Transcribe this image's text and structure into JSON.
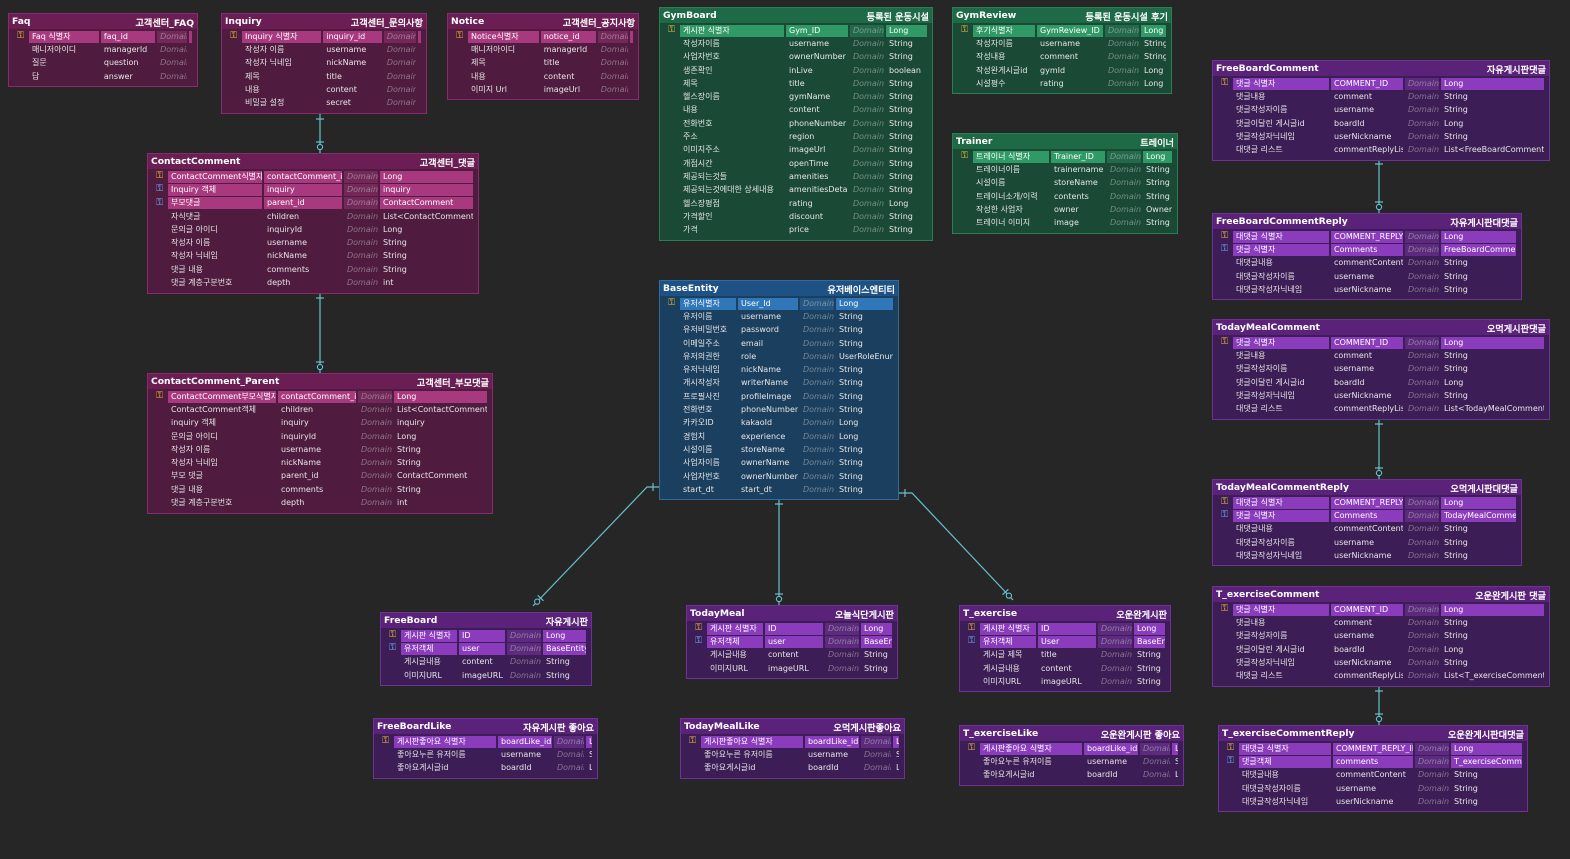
{
  "colors": {
    "background": "#262626",
    "pink": "#6a1e53",
    "green": "#1e6a46",
    "blue": "#1e5285",
    "purple": "#5a2379",
    "connector": "#66c2cc",
    "pk_key": "#f1c232",
    "fk_key": "#6fb4ff"
  },
  "entities": [
    {
      "id": "faq",
      "theme": "pink",
      "name": "Faq",
      "label": "고객센터_FAQ",
      "cols": [
        80,
        62,
        34
      ],
      "rows": [
        [
          "pk",
          "Faq 식별자",
          "faq_id",
          "Domain",
          "Long"
        ],
        [
          "",
          "매니저아이디",
          "managerId",
          "Domain",
          "Long"
        ],
        [
          "",
          "질문",
          "question",
          "Domain",
          "String"
        ],
        [
          "",
          "답",
          "answer",
          "Domain",
          "String"
        ]
      ]
    },
    {
      "id": "inquiry",
      "theme": "pink",
      "name": "Inquiry",
      "label": "고객센터_문의사항",
      "cols": [
        84,
        62,
        34
      ],
      "rows": [
        [
          "pk",
          "Inquiry 식별자",
          "inquiry_id",
          "Domain",
          "Long"
        ],
        [
          "",
          "작성자 이름",
          "username",
          "Domain",
          "String"
        ],
        [
          "",
          "작성자 닉네임",
          "nickName",
          "Domain",
          "String"
        ],
        [
          "",
          "제목",
          "title",
          "Domain",
          "String"
        ],
        [
          "",
          "내용",
          "content",
          "Domain",
          "String"
        ],
        [
          "",
          "비밀글 설정",
          "secret",
          "Domain",
          "Boolean"
        ]
      ]
    },
    {
      "id": "notice",
      "theme": "pink",
      "name": "Notice",
      "label": "고객센터_공지사항",
      "cols": [
        80,
        62,
        34
      ],
      "rows": [
        [
          "pk",
          "Notice식별자",
          "notice_id",
          "Domain",
          "Long"
        ],
        [
          "",
          "매니저아이디",
          "managerId",
          "Domain",
          "Long"
        ],
        [
          "",
          "제목",
          "title",
          "Domain",
          "String"
        ],
        [
          "",
          "내용",
          "content",
          "Domain",
          "String"
        ],
        [
          "",
          "이미지 Url",
          "imageUrl",
          "Domain",
          "String"
        ]
      ]
    },
    {
      "id": "contactcomment",
      "theme": "pink",
      "name": "ContactComment",
      "label": "고객센터_댓글",
      "cols": [
        94,
        78,
        34
      ],
      "rows": [
        [
          "pk",
          "ContactComment식별자",
          "contactComment_id",
          "Domain",
          "Long"
        ],
        [
          "fk",
          "Inquiry 객체",
          "inquiry",
          "Domain",
          "inquiry"
        ],
        [
          "fk",
          "부모댓글",
          "parent_id",
          "Domain",
          "ContactComment"
        ],
        [
          "",
          "자식댓글",
          "children",
          "Domain",
          "List<ContactComment>"
        ],
        [
          "",
          "문의글 아이디",
          "inquiryId",
          "Domain",
          "Long"
        ],
        [
          "",
          "작성자 이름",
          "username",
          "Domain",
          "String"
        ],
        [
          "",
          "작성자 닉네임",
          "nickName",
          "Domain",
          "String"
        ],
        [
          "",
          "댓글 내용",
          "comments",
          "Domain",
          "String"
        ],
        [
          "",
          "댓글 계층구분번호",
          "depth",
          "Domain",
          "int"
        ]
      ]
    },
    {
      "id": "contactparent",
      "theme": "pink",
      "name": "ContactComment_Parent",
      "label": "고객센터_부모댓글",
      "cols": [
        108,
        78,
        34
      ],
      "rows": [
        [
          "pk",
          "ContactComment부모식별자",
          "contactComment_id",
          "Domain",
          "Long"
        ],
        [
          "",
          "ContactComment객체",
          "children",
          "Domain",
          "List<ContactComment>"
        ],
        [
          "",
          "inquiry 객체",
          "inquiry",
          "Domain",
          "inquiry"
        ],
        [
          "",
          "문의글 아이디",
          "inquiryId",
          "Domain",
          "Long"
        ],
        [
          "",
          "작성자 이름",
          "username",
          "Domain",
          "String"
        ],
        [
          "",
          "작성자 닉네임",
          "nickName",
          "Domain",
          "String"
        ],
        [
          "",
          "부모 댓글",
          "parent_id",
          "Domain",
          "ContactComment"
        ],
        [
          "",
          "댓글 내용",
          "comments",
          "Domain",
          "String"
        ],
        [
          "",
          "댓글 계층구분번호",
          "depth",
          "Domain",
          "int"
        ]
      ]
    },
    {
      "id": "gymboard",
      "theme": "green",
      "name": "GymBoard",
      "label": "등록된 운동시설",
      "cols": [
        104,
        62,
        34
      ],
      "rows": [
        [
          "pk",
          "게시판 식별자",
          "Gym_ID",
          "Domain",
          "Long"
        ],
        [
          "",
          "작성자이름",
          "username",
          "Domain",
          "String"
        ],
        [
          "",
          "사업자번호",
          "ownerNumber",
          "Domain",
          "String"
        ],
        [
          "",
          "생존확인",
          "inLive",
          "Domain",
          "boolean"
        ],
        [
          "",
          "제목",
          "title",
          "Domain",
          "String"
        ],
        [
          "",
          "헬스장이름",
          "gymName",
          "Domain",
          "String"
        ],
        [
          "",
          "내용",
          "content",
          "Domain",
          "String"
        ],
        [
          "",
          "전화번호",
          "phoneNumber",
          "Domain",
          "String"
        ],
        [
          "",
          "주소",
          "region",
          "Domain",
          "String"
        ],
        [
          "",
          "이미지주소",
          "imageUrl",
          "Domain",
          "String"
        ],
        [
          "",
          "개점시간",
          "openTime",
          "Domain",
          "String"
        ],
        [
          "",
          "제공되는것들",
          "amenities",
          "Domain",
          "String"
        ],
        [
          "",
          "제공되는것에대한 상세내용",
          "amenitiesDetail",
          "Domain",
          "String"
        ],
        [
          "",
          "헬스장평점",
          "rating",
          "Domain",
          "Long"
        ],
        [
          "",
          "가격할인",
          "discount",
          "Domain",
          "String"
        ],
        [
          "",
          "가격",
          "price",
          "Domain",
          "String"
        ]
      ]
    },
    {
      "id": "gymreview",
      "theme": "green",
      "name": "GymReview",
      "label": "등록된 운동시설 후기",
      "cols": [
        62,
        66,
        34
      ],
      "rows": [
        [
          "pk",
          "후기식별자",
          "GymReview_ID",
          "Domain",
          "Long"
        ],
        [
          "",
          "작성자이름",
          "username",
          "Domain",
          "String"
        ],
        [
          "",
          "작성내용",
          "comment",
          "Domain",
          "String"
        ],
        [
          "",
          "작성완게시글id",
          "gymId",
          "Domain",
          "Long"
        ],
        [
          "",
          "시설평수",
          "rating",
          "Domain",
          "Long"
        ]
      ]
    },
    {
      "id": "trainer",
      "theme": "green",
      "name": "Trainer",
      "label": "트레이너",
      "cols": [
        76,
        54,
        34
      ],
      "rows": [
        [
          "pk",
          "트레이너 식별자",
          "Trainer_ID",
          "Domain",
          "Long"
        ],
        [
          "",
          "트레이너이름",
          "trainername",
          "Domain",
          "String"
        ],
        [
          "",
          "시설이름",
          "storeName",
          "Domain",
          "String"
        ],
        [
          "",
          "트레이너소개/이력",
          "contents",
          "Domain",
          "String"
        ],
        [
          "",
          "작성한 사업자",
          "owner",
          "Domain",
          "Owner"
        ],
        [
          "",
          "트레이너 이미지",
          "image",
          "Domain",
          "String"
        ]
      ]
    },
    {
      "id": "baseentity",
      "theme": "blue",
      "name": "BaseEntity",
      "label": "유저베이스엔티티",
      "cols": [
        56,
        60,
        34
      ],
      "rows": [
        [
          "pk",
          "유저식별자",
          "User_Id",
          "Domain",
          "Long"
        ],
        [
          "",
          "유저이름",
          "username",
          "Domain",
          "String"
        ],
        [
          "",
          "유저비밀번호",
          "password",
          "Domain",
          "String"
        ],
        [
          "",
          "이메일주소",
          "email",
          "Domain",
          "String"
        ],
        [
          "",
          "유저의권한",
          "role",
          "Domain",
          "UserRoleEnum"
        ],
        [
          "",
          "유저닉네임",
          "nickName",
          "Domain",
          "String"
        ],
        [
          "",
          "개시작성자",
          "writerName",
          "Domain",
          "String"
        ],
        [
          "",
          "프로필사진",
          "profileImage",
          "Domain",
          "String"
        ],
        [
          "",
          "전화번호",
          "phoneNumber",
          "Domain",
          "String"
        ],
        [
          "",
          "카카오ID",
          "kakaoId",
          "Domain",
          "Long"
        ],
        [
          "",
          "경험치",
          "experience",
          "Domain",
          "Long"
        ],
        [
          "",
          "시설이름",
          "storeName",
          "Domain",
          "String"
        ],
        [
          "",
          "사업자이름",
          "ownerName",
          "Domain",
          "String"
        ],
        [
          "",
          "사업자번호",
          "ownerNumber",
          "Domain",
          "String"
        ],
        [
          "",
          "start_dt",
          "start_dt",
          "Domain",
          "String"
        ]
      ]
    },
    {
      "id": "freeboard",
      "theme": "purple",
      "name": "FreeBoard",
      "label": "자유게시판",
      "cols": [
        56,
        46,
        34
      ],
      "rows": [
        [
          "pk",
          "게시판 식별자",
          "ID",
          "Domain",
          "Long"
        ],
        [
          "fk",
          "유저객체",
          "user",
          "Domain",
          "BaseEntity"
        ],
        [
          "",
          "게시글내용",
          "content",
          "Domain",
          "String"
        ],
        [
          "",
          "이미지URL",
          "imageURL",
          "Domain",
          "String"
        ]
      ]
    },
    {
      "id": "todaymeal",
      "theme": "purple",
      "name": "TodayMeal",
      "label": "오늘식단게시판",
      "cols": [
        56,
        58,
        34
      ],
      "rows": [
        [
          "pk",
          "게시판 식별자",
          "ID",
          "Domain",
          "Long"
        ],
        [
          "fk",
          "유저객체",
          "user",
          "Domain",
          "BaseEntity"
        ],
        [
          "",
          "게시글내용",
          "content",
          "Domain",
          "String"
        ],
        [
          "",
          "이미지URL",
          "imageURL",
          "Domain",
          "String"
        ]
      ]
    },
    {
      "id": "texercise",
      "theme": "purple",
      "name": "T_exercise",
      "label": "오운완게시판",
      "cols": [
        56,
        58,
        34
      ],
      "rows": [
        [
          "pk",
          "게시판 식별자",
          "ID",
          "Domain",
          "Long"
        ],
        [
          "fk",
          "유저객체",
          "User",
          "Domain",
          "BaseEntity"
        ],
        [
          "",
          "게시글 제목",
          "title",
          "Domain",
          "String"
        ],
        [
          "",
          "게시글내용",
          "content",
          "Domain",
          "String"
        ],
        [
          "",
          "이미지URL",
          "imageURL",
          "Domain",
          "String"
        ]
      ]
    },
    {
      "id": "freeboardlike",
      "theme": "purple",
      "name": "FreeBoardLike",
      "label": "자유게시판 좋아요",
      "cols": [
        102,
        54,
        30
      ],
      "rows": [
        [
          "pk",
          "게시판좋아요 식별자",
          "boardLike_id",
          "Domain",
          "Long"
        ],
        [
          "",
          "좋아요누른 유저이름",
          "username",
          "Domain",
          "String"
        ],
        [
          "",
          "좋아요게시글id",
          "boardId",
          "Domain",
          "Long"
        ]
      ]
    },
    {
      "id": "todaymeallike",
      "theme": "purple",
      "name": "TodayMealLike",
      "label": "오먹게시판좋아요",
      "cols": [
        102,
        54,
        30
      ],
      "rows": [
        [
          "pk",
          "게시판좋아요 식별자",
          "boardLike_id",
          "Domain",
          "Long"
        ],
        [
          "",
          "좋아요누른 유저이름",
          "username",
          "Domain",
          "String"
        ],
        [
          "",
          "좋아요게시글id",
          "boardId",
          "Domain",
          "Long"
        ]
      ]
    },
    {
      "id": "texerciselike",
      "theme": "purple",
      "name": "T_exerciseLike",
      "label": "오운완게시판 좋아요",
      "cols": [
        102,
        54,
        30
      ],
      "rows": [
        [
          "pk",
          "게시판좋아요 식별자",
          "boardLike_id",
          "Domain",
          "Long"
        ],
        [
          "",
          "좋아요누른 유저이름",
          "username",
          "Domain",
          "String"
        ],
        [
          "",
          "좋아요게시글id",
          "boardId",
          "Domain",
          "Long"
        ]
      ]
    },
    {
      "id": "freeboardcomment",
      "theme": "purple",
      "name": "FreeBoardComment",
      "label": "자유게시판댓글",
      "cols": [
        96,
        72,
        34
      ],
      "rows": [
        [
          "pk",
          "댓글 식별자",
          "COMMENT_ID",
          "Domain",
          "Long"
        ],
        [
          "",
          "댓글내용",
          "comment",
          "Domain",
          "String"
        ],
        [
          "",
          "댓글작성자이름",
          "username",
          "Domain",
          "String"
        ],
        [
          "",
          "댓글이달린 게시글id",
          "boardId",
          "Domain",
          "Long"
        ],
        [
          "",
          "댓글작성자닉네임",
          "userNickname",
          "Domain",
          "String"
        ],
        [
          "",
          "대댓글 리스트",
          "commentReplyList",
          "Domain",
          "List<FreeBoardCommentReply>"
        ]
      ]
    },
    {
      "id": "freeboardcommentreply",
      "theme": "purple",
      "name": "FreeBoardCommentReply",
      "label": "자유게시판대댓글",
      "cols": [
        96,
        72,
        34
      ],
      "rows": [
        [
          "pk",
          "대댓글 식별자",
          "COMMENT_REPLY_ID",
          "Domain",
          "Long"
        ],
        [
          "fk",
          "댓글 식별자",
          "Comments",
          "Domain",
          "FreeBoardComment"
        ],
        [
          "",
          "대댓글내용",
          "commentContent",
          "Domain",
          "String"
        ],
        [
          "",
          "대댓글작성자이름",
          "username",
          "Domain",
          "String"
        ],
        [
          "",
          "대댓글작성자닉네임",
          "userNickname",
          "Domain",
          "String"
        ]
      ]
    },
    {
      "id": "todaymealcomment",
      "theme": "purple",
      "name": "TodayMealComment",
      "label": "오먹게시판댓글",
      "cols": [
        96,
        72,
        34
      ],
      "rows": [
        [
          "pk",
          "댓글 식별자",
          "COMMENT_ID",
          "Domain",
          "Long"
        ],
        [
          "",
          "댓글내용",
          "comment",
          "Domain",
          "String"
        ],
        [
          "",
          "댓글작성자이름",
          "username",
          "Domain",
          "String"
        ],
        [
          "",
          "댓글이달린 게시글id",
          "boardId",
          "Domain",
          "Long"
        ],
        [
          "",
          "댓글작성자닉네임",
          "userNickname",
          "Domain",
          "String"
        ],
        [
          "",
          "대댓글 리스트",
          "commentReplyList",
          "Domain",
          "List<TodayMealCommentReply>"
        ]
      ]
    },
    {
      "id": "todaymealcommentreply",
      "theme": "purple",
      "name": "TodayMealCommentReply",
      "label": "오먹게시판대댓글",
      "cols": [
        96,
        72,
        34
      ],
      "rows": [
        [
          "pk",
          "대댓글 식별자",
          "COMMENT_REPLY_ID",
          "Domain",
          "Long"
        ],
        [
          "fk",
          "댓글 식별자",
          "Comments",
          "Domain",
          "TodayMealComment"
        ],
        [
          "",
          "대댓글내용",
          "commentContent",
          "Domain",
          "String"
        ],
        [
          "",
          "대댓글작성자이름",
          "username",
          "Domain",
          "String"
        ],
        [
          "",
          "대댓글작성자닉네임",
          "userNickname",
          "Domain",
          "String"
        ]
      ]
    },
    {
      "id": "texercisecomment",
      "theme": "purple",
      "name": "T_exerciseComment",
      "label": "오운완게시판 댓글",
      "cols": [
        96,
        72,
        34
      ],
      "rows": [
        [
          "pk",
          "댓글 식별자",
          "COMMENT_ID",
          "Domain",
          "Long"
        ],
        [
          "",
          "댓글내용",
          "comment",
          "Domain",
          "String"
        ],
        [
          "",
          "댓글작성자이름",
          "username",
          "Domain",
          "String"
        ],
        [
          "",
          "댓글이달린 게시글id",
          "boardId",
          "Domain",
          "Long"
        ],
        [
          "",
          "댓글작성자닉네임",
          "userNickname",
          "Domain",
          "String"
        ],
        [
          "",
          "대댓글 리스트",
          "commentReplyList",
          "Domain",
          "List<T_exerciseCommentReply>"
        ]
      ]
    },
    {
      "id": "texercisecommentreply",
      "theme": "purple",
      "name": "T_exerciseCommentReply",
      "label": "오운완게시판대댓글",
      "cols": [
        92,
        80,
        34
      ],
      "rows": [
        [
          "pk",
          "대댓글 식별자",
          "COMMENT_REPLY_ID",
          "Domain",
          "Long"
        ],
        [
          "fk",
          "댓글객체",
          "comments",
          "Domain",
          "T_exerciseComment"
        ],
        [
          "",
          "대댓글내용",
          "commentContent",
          "Domain",
          "String"
        ],
        [
          "",
          "대댓글작성자이름",
          "username",
          "Domain",
          "String"
        ],
        [
          "",
          "대댓글작성자닉네임",
          "userNickname",
          "Domain",
          "String"
        ]
      ]
    }
  ]
}
